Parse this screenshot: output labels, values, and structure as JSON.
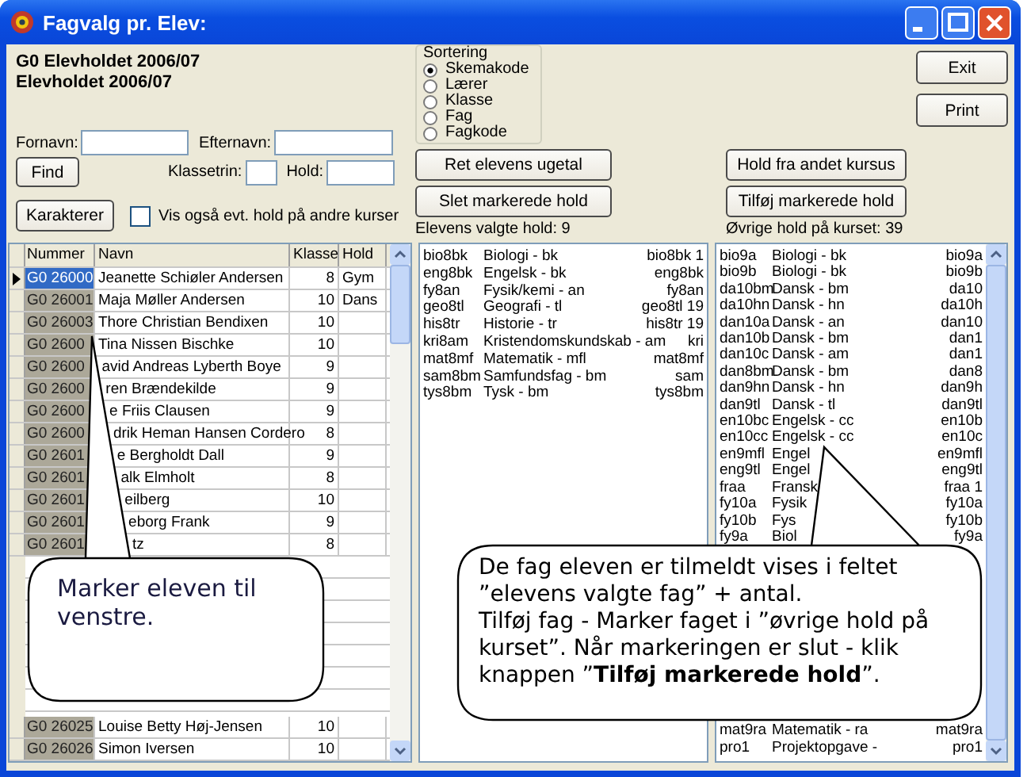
{
  "window": {
    "title": "Fagvalg pr. Elev:"
  },
  "header": {
    "line_1": "G0  Elevholdet 2006/07",
    "line_2": "Elevholdet 2006/07"
  },
  "search": {
    "first_name_label": "Fornavn:",
    "last_name_label": "Efternavn:",
    "find_button": {
      "label": "Find"
    },
    "grade_label": "Klassetrin:",
    "team_label": "Hold:"
  },
  "grades_button": {
    "label": "Karakterer"
  },
  "show_other": {
    "label": "Vis også evt. hold på andre kurser",
    "checked": false
  },
  "sorting": {
    "title": "Sortering",
    "options": [
      {
        "label": "Skemakode",
        "selected": true
      },
      {
        "label": "Lærer",
        "selected": false
      },
      {
        "label": "Klasse",
        "selected": false
      },
      {
        "label": "Fag",
        "selected": false
      },
      {
        "label": "Fagkode",
        "selected": false
      }
    ]
  },
  "exit_button": {
    "label": "Exit"
  },
  "print_button": {
    "label": "Print"
  },
  "edit_hours_button": {
    "label": "Ret elevens ugetal"
  },
  "delete_button": {
    "label": "Slet markerede hold"
  },
  "other_course_button": {
    "label": "Hold fra andet kursus"
  },
  "add_button": {
    "label": "Tilføj markerede hold"
  },
  "chosen_label": "Elevens valgte hold: 9",
  "other_label": "Øvrige hold på kurset: 39",
  "student_grid": {
    "columns": [
      "Nummer",
      "Navn",
      "Klasse",
      "Hold"
    ],
    "rows_top": [
      {
        "number": "G0 26000",
        "name": "Jeanette Schiøler Andersen",
        "grade": "8",
        "team": "Gym",
        "selected": true
      },
      {
        "number": "G0 26001",
        "name": "Maja Møller Andersen",
        "grade": "10",
        "team": "Dans",
        "selected": false
      },
      {
        "number": "G0 26003",
        "name": "Thore Christian Bendixen",
        "grade": "10",
        "selected": false
      },
      {
        "number": "G0 2600",
        "name": "Tina Nissen Bischke",
        "grade": "10",
        "selected": false
      },
      {
        "number": "G0 2600",
        "name": "avid Andreas Lyberth Boye",
        "grade": "9",
        "selected": false
      },
      {
        "number": "G0 2600",
        "name": "ren Brændekilde",
        "grade": "9",
        "selected": false
      },
      {
        "number": "G0 2600",
        "name": "e Friis Clausen",
        "grade": "9",
        "selected": false
      },
      {
        "number": "G0 2600",
        "name": "drik Heman Hansen Cordero",
        "grade": "8",
        "selected": false
      },
      {
        "number": "G0 2601",
        "name": "e Bergholdt Dall",
        "grade": "9",
        "selected": false
      },
      {
        "number": "G0 2601",
        "name": "alk Elmholt",
        "grade": "8",
        "selected": false
      },
      {
        "number": "G0 2601",
        "name": "eilberg",
        "grade": "10",
        "selected": false
      },
      {
        "number": "G0 2601",
        "name": "eborg Frank",
        "grade": "9",
        "selected": false
      },
      {
        "number": "G0 2601",
        "name": "tz",
        "grade": "8",
        "selected": false
      }
    ],
    "rows_bottom": [
      {
        "number": "G0 26025",
        "name": "Louise Betty Høj-Jensen",
        "grade": "10",
        "selected": false
      },
      {
        "number": "G0 26026",
        "name": "Simon Iversen",
        "grade": "10",
        "selected": false
      }
    ]
  },
  "chosen_list": [
    {
      "code": "bio8bk",
      "name": "Biologi - bk",
      "extra": "bio8bk  1"
    },
    {
      "code": "eng8bk",
      "name": "Engelsk - bk",
      "extra": "eng8bk"
    },
    {
      "code": "fy8an",
      "name": "Fysik/kemi - an",
      "extra": "fy8an"
    },
    {
      "code": "geo8tl",
      "name": "Geografi - tl",
      "extra": "geo8tl  19"
    },
    {
      "code": "his8tr",
      "name": "Historie - tr",
      "extra": "his8tr  19"
    },
    {
      "code": "kri8am",
      "name": "Kristendomskundskab - am",
      "extra": "kri"
    },
    {
      "code": "mat8mf",
      "name": "Matematik - mfl",
      "extra": "mat8mf"
    },
    {
      "code": "sam8bm",
      "name": "Samfundsfag - bm",
      "extra": "sam"
    },
    {
      "code": "tys8bm",
      "name": "Tysk - bm",
      "extra": "tys8bm"
    }
  ],
  "other_list": {
    "rows_top": [
      {
        "code": "bio9a",
        "name": "Biologi - bk",
        "extra": "bio9a"
      },
      {
        "code": "bio9b",
        "name": "Biologi - bk",
        "extra": "bio9b"
      },
      {
        "code": "da10bm",
        "name": "Dansk - bm",
        "extra": "da10"
      },
      {
        "code": "da10hn",
        "name": "Dansk - hn",
        "extra": "da10h"
      },
      {
        "code": "dan10a",
        "name": "Dansk - an",
        "extra": "dan10"
      },
      {
        "code": "dan10b",
        "name": "Dansk - bm",
        "extra": "dan1"
      },
      {
        "code": "dan10c",
        "name": "Dansk - am",
        "extra": "dan1"
      },
      {
        "code": "dan8bm",
        "name": "Dansk - bm",
        "extra": "dan8"
      },
      {
        "code": "dan9hn",
        "name": "Dansk - hn",
        "extra": "dan9h"
      },
      {
        "code": "dan9tl",
        "name": "Dansk - tl",
        "extra": "dan9tl"
      },
      {
        "code": "en10bc",
        "name": "Engelsk - cc",
        "extra": "en10b"
      },
      {
        "code": "en10cc",
        "name": "Engelsk - cc",
        "extra": "en10c"
      },
      {
        "code": "en9mfl",
        "name": "Engel",
        "extra": "en9mfl"
      },
      {
        "code": "eng9tl",
        "name": "Engel",
        "extra": "eng9tl"
      },
      {
        "code": "fraa",
        "name": "Fransk",
        "extra": "fraa  1"
      },
      {
        "code": "fy10a",
        "name": "Fysik",
        "extra": "fy10a"
      },
      {
        "code": "fy10b",
        "name": "Fys",
        "extra": "fy10b"
      },
      {
        "code": "fy9a",
        "name": "Biol",
        "extra": "fy9a"
      }
    ],
    "rows_bottom": [
      {
        "code": "mat9ra",
        "name": "Matematik - ra",
        "extra": "mat9ra"
      },
      {
        "code": "pro1",
        "name": "Projektopgave -",
        "extra": "pro1"
      }
    ]
  },
  "callouts": [
    {
      "kind": "left",
      "paragraphs": [
        "Marker eleven til venstre."
      ]
    },
    {
      "kind": "right",
      "paragraphs": [
        "De fag eleven er tilmeldt vises i feltet ”elevens valgte fag” + antal.",
        "Tilføj fag - Marker faget i ”øvrige hold på kurset”. Når markeringen er slut - klik knappen ”**Tilføj markerede hold**”."
      ]
    }
  ]
}
